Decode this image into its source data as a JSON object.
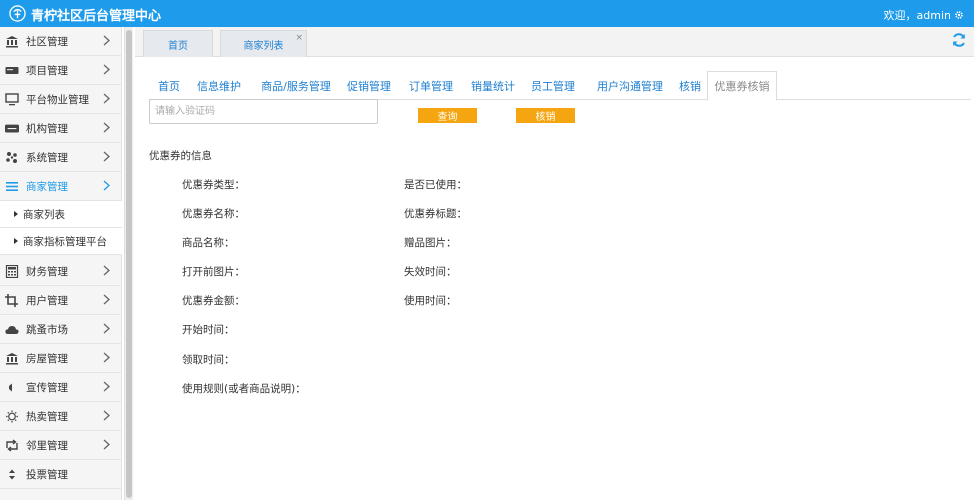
{
  "header": {
    "title": "青柠社区后台管理中心",
    "welcome": "欢迎，admin",
    "logo_icon": "leaf-logo-icon",
    "settings_icon": "gear-icon",
    "bg_color": "#1e9bea"
  },
  "sidebar": {
    "items": [
      {
        "label": "社区管理",
        "icon": "bank-icon"
      },
      {
        "label": "项目管理",
        "icon": "card-icon"
      },
      {
        "label": "平台物业管理",
        "icon": "monitor-icon"
      },
      {
        "label": "机构管理",
        "icon": "stripe-icon"
      },
      {
        "label": "系统管理",
        "icon": "yelp-icon"
      },
      {
        "label": "商家管理",
        "icon": "list-icon"
      },
      {
        "label": "财务管理",
        "icon": "calculator-icon"
      },
      {
        "label": "用户管理",
        "icon": "crop-icon"
      },
      {
        "label": "跳蚤市场",
        "icon": "cloud-icon"
      },
      {
        "label": "房屋管理",
        "icon": "bank-icon"
      },
      {
        "label": "宣传管理",
        "icon": "volume-icon"
      },
      {
        "label": "热卖管理",
        "icon": "sun-icon"
      },
      {
        "label": "邻里管理",
        "icon": "retweet-icon"
      },
      {
        "label": "投票管理",
        "icon": "sort-icon"
      }
    ],
    "active_item": "商家管理",
    "subitems": [
      {
        "label": "商家列表"
      },
      {
        "label": "商家指标管理平台"
      }
    ]
  },
  "tabs": [
    {
      "label": "首页"
    },
    {
      "label": "商家列表",
      "close": "×"
    }
  ],
  "subnav": [
    {
      "label": "首页"
    },
    {
      "label": "信息维护"
    },
    {
      "label": "商品/服务管理"
    },
    {
      "label": "促销管理"
    },
    {
      "label": "订单管理"
    },
    {
      "label": "销量统计"
    },
    {
      "label": "员工管理"
    },
    {
      "label": "用户沟通管理"
    },
    {
      "label": "核销"
    },
    {
      "label": "优惠券核销"
    }
  ],
  "active_subnav": "优惠券核销",
  "search": {
    "placeholder": "请输入验证码",
    "value": "",
    "query_button": "查询",
    "verify_button": "核销",
    "button_color": "#f5a510"
  },
  "coupon": {
    "section_title": "优惠券的信息",
    "left_fields": [
      "优惠券类型：",
      "优惠券名称：",
      "商品名称：",
      "打开前图片：",
      "优惠券金额：",
      "开始时间：",
      "领取时间：",
      "使用规则(或者商品说明)："
    ],
    "right_fields": [
      "是否已使用：",
      "优惠券标题：",
      "赠品图片：",
      "失效时间：",
      "使用时间："
    ]
  }
}
